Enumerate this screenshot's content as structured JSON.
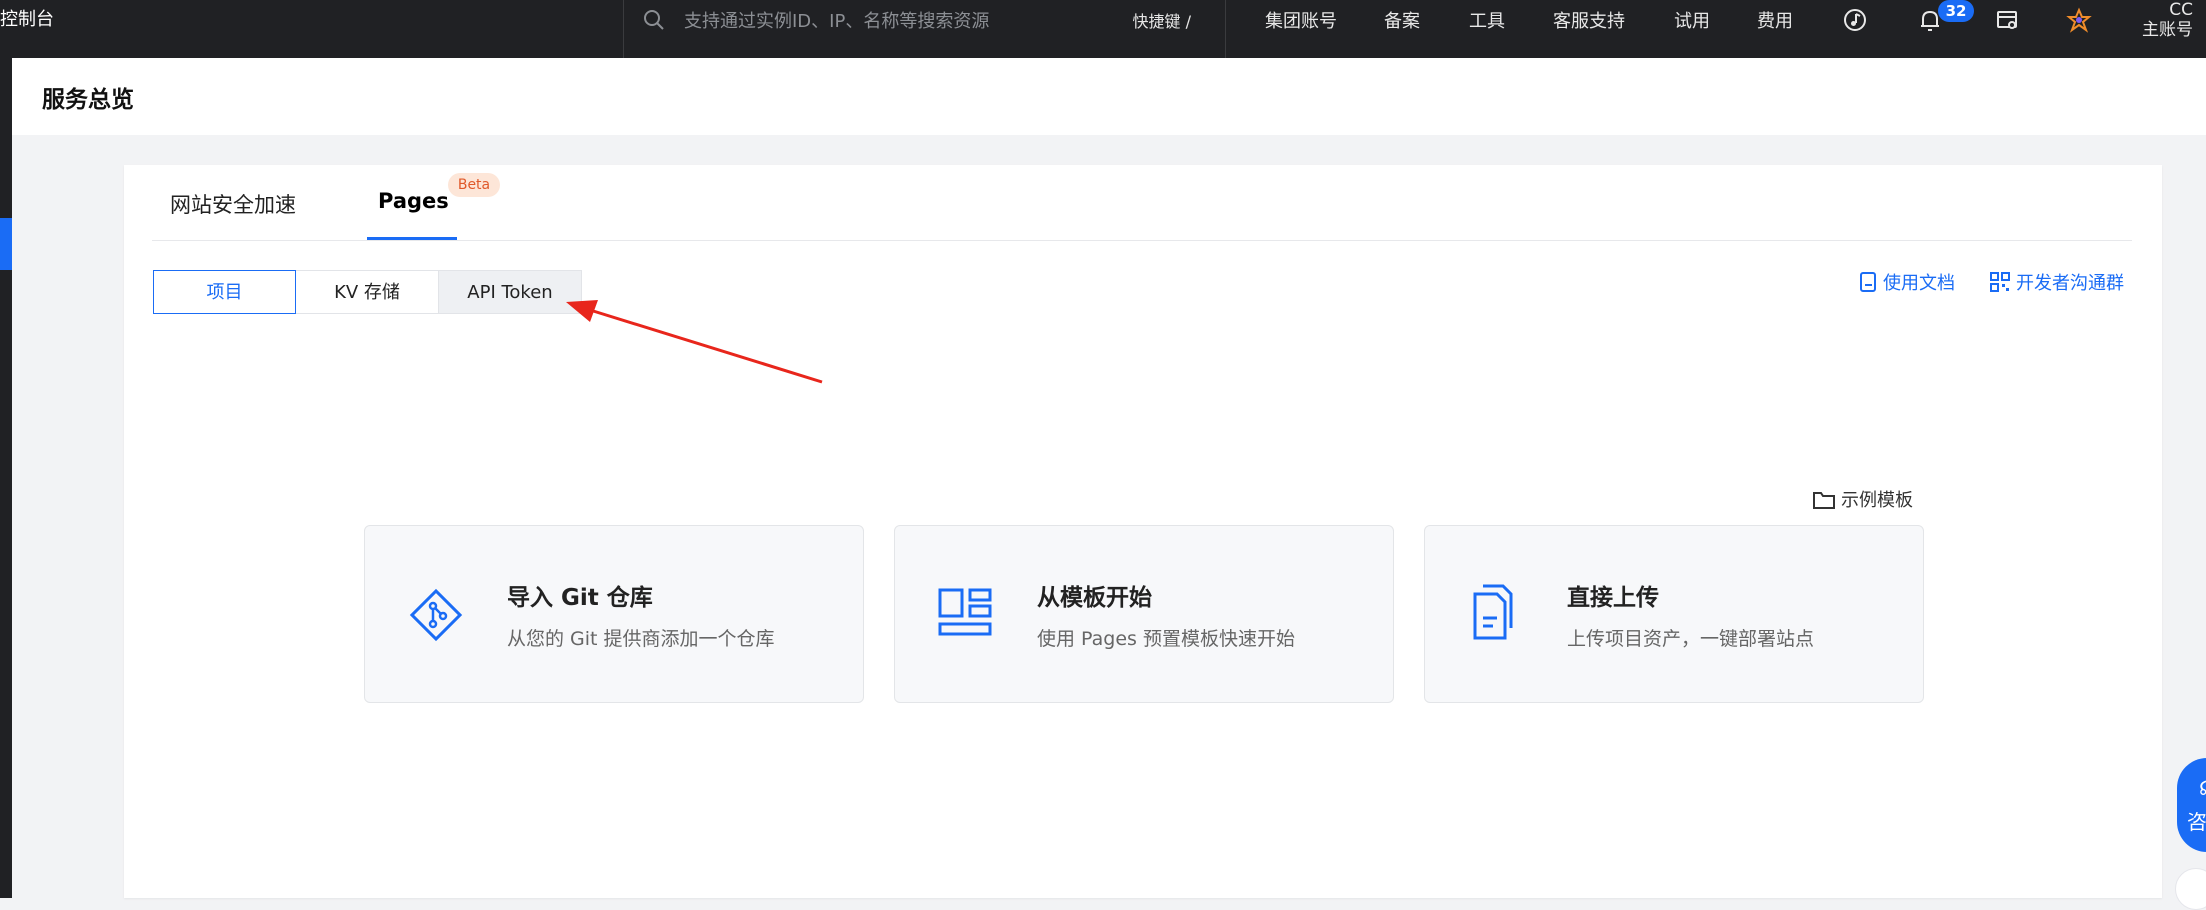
{
  "topbar": {
    "brand": "控制台",
    "search_placeholder": "支持通过实例ID、IP、名称等搜索资源",
    "shortcut": "快捷键 /",
    "nav": [
      "集团账号",
      "备案",
      "工具",
      "客服支持",
      "试用",
      "费用"
    ],
    "notification_count": "32",
    "account_name": "CC",
    "account_type": "主账号"
  },
  "header": {
    "title": "服务总览"
  },
  "tabs": [
    {
      "label": "网站安全加速"
    },
    {
      "label": "Pages",
      "badge": "Beta"
    }
  ],
  "segments": [
    "项目",
    "KV 存储",
    "API Token"
  ],
  "links": {
    "docs": "使用文档",
    "dev_group": "开发者沟通群"
  },
  "template_link": "示例模板",
  "options": [
    {
      "title": "导入 Git 仓库",
      "desc": "从您的 Git 提供商添加一个仓库",
      "icon": "git-icon"
    },
    {
      "title": "从模板开始",
      "desc": "使用 Pages 预置模板快速开始",
      "icon": "layout-template-icon"
    },
    {
      "title": "直接上传",
      "desc": "上传项目资产，一键部署站点",
      "icon": "documents-upload-icon"
    }
  ],
  "float": {
    "label": "咨"
  },
  "colors": {
    "accent": "#1a6cf5",
    "topbar": "#202124",
    "annotation": "#e8261c"
  }
}
